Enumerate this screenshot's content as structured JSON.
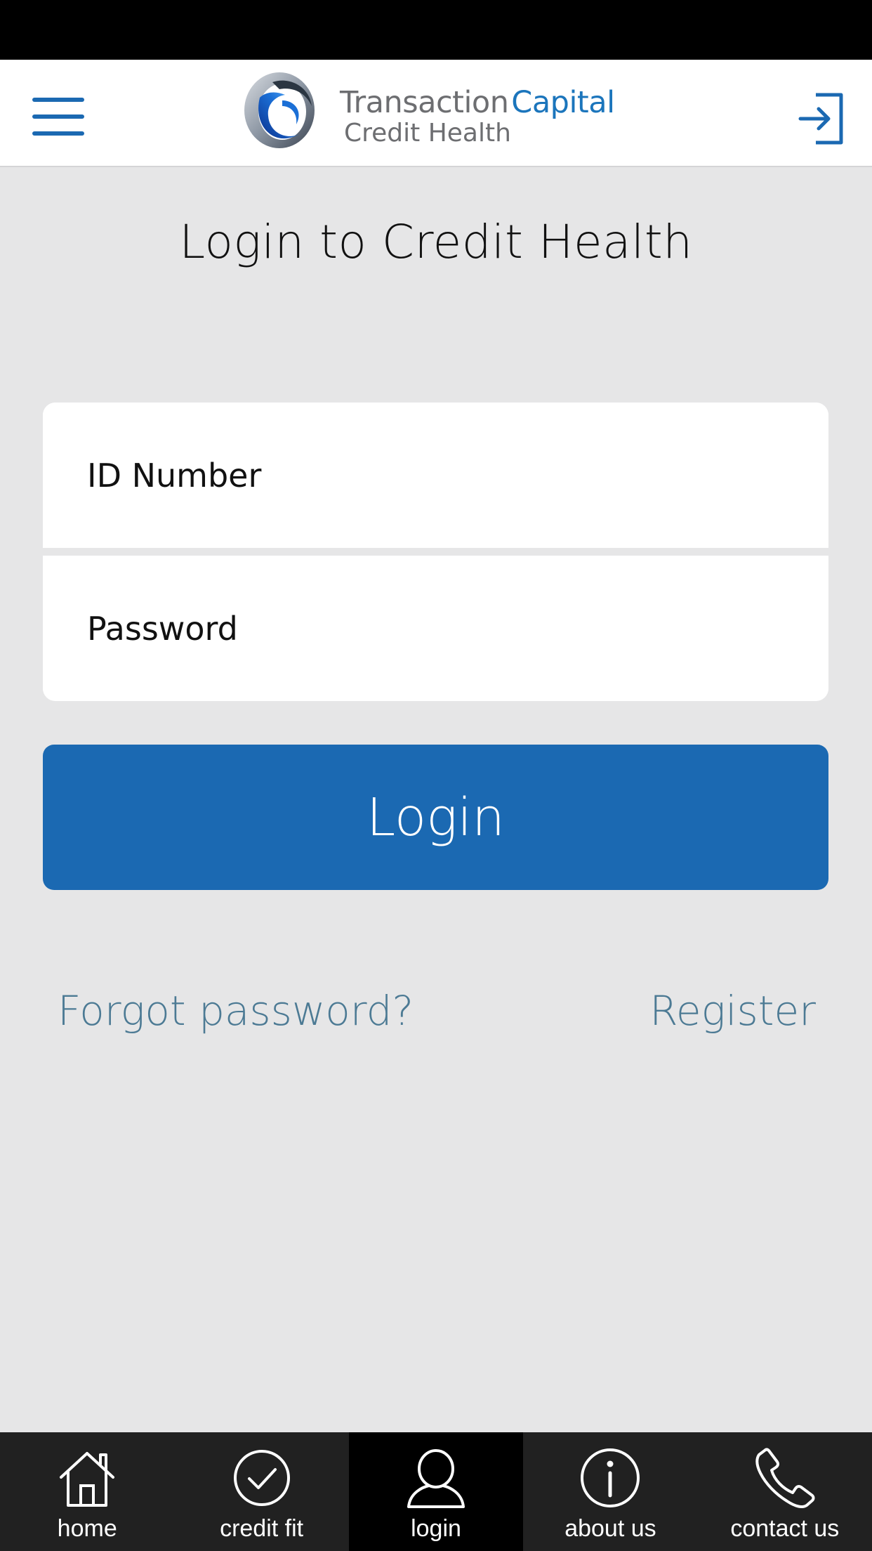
{
  "header": {
    "brand_line1_a": "Transaction",
    "brand_line1_b": "Capital",
    "brand_line2": "Credit Health",
    "menu_icon": "hamburger-menu-icon",
    "signin_icon": "sign-in-icon"
  },
  "main": {
    "title": "Login to Credit Health",
    "id_placeholder": "ID Number",
    "password_placeholder": "Password",
    "login_label": "Login",
    "forgot_label": "Forgot password?",
    "register_label": "Register"
  },
  "nav": {
    "items": [
      {
        "label": "home",
        "icon": "home-icon"
      },
      {
        "label": "credit fit",
        "icon": "check-circle-icon"
      },
      {
        "label": "login",
        "icon": "user-icon",
        "active": true
      },
      {
        "label": "about us",
        "icon": "info-icon"
      },
      {
        "label": "contact us",
        "icon": "phone-icon"
      }
    ]
  },
  "colors": {
    "brand_blue": "#1b69b2",
    "link": "#4c7a94",
    "background": "#e6e6e7",
    "nav_background": "#212121",
    "nav_active": "#000000"
  }
}
